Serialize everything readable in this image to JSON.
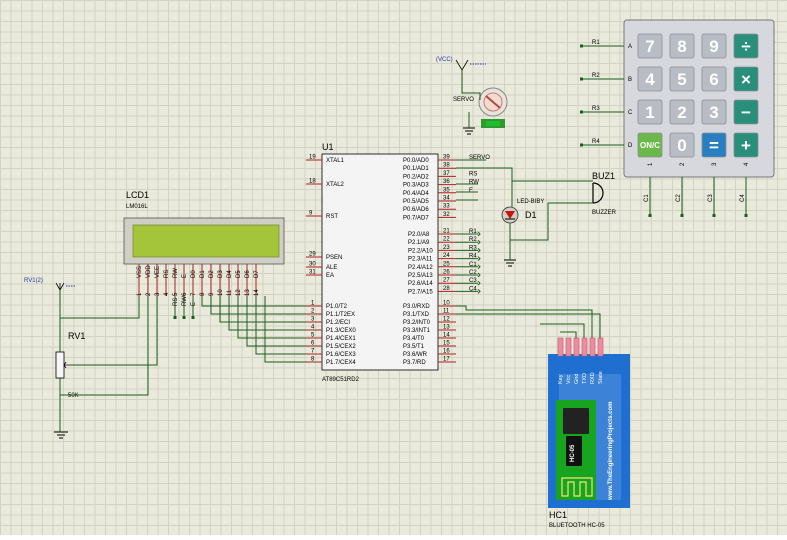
{
  "u1": {
    "ref": "U1",
    "part": "AT89C51RD2",
    "left_pins": [
      {
        "num": "19",
        "name": "XTAL1"
      },
      {
        "num": "18",
        "name": "XTAL2"
      },
      {
        "num": "9",
        "name": "RST"
      },
      {
        "num": "29",
        "name": "PSEN"
      },
      {
        "num": "30",
        "name": "ALE"
      },
      {
        "num": "31",
        "name": "EA"
      }
    ],
    "p1_pins": [
      {
        "num": "1",
        "name": "P1.0/T2"
      },
      {
        "num": "2",
        "name": "P1.1/T2EX"
      },
      {
        "num": "3",
        "name": "P1.2/ECI"
      },
      {
        "num": "4",
        "name": "P1.3/CEX0"
      },
      {
        "num": "5",
        "name": "P1.4/CEX1"
      },
      {
        "num": "6",
        "name": "P1.5/CEX2"
      },
      {
        "num": "7",
        "name": "P1.6/CEX3"
      },
      {
        "num": "8",
        "name": "P1.7/CEX4"
      }
    ],
    "p0_pins": [
      {
        "num": "39",
        "name": "P0.0/AD0"
      },
      {
        "num": "38",
        "name": "P0.1/AD1"
      },
      {
        "num": "37",
        "name": "P0.2/AD2"
      },
      {
        "num": "36",
        "name": "P0.3/AD3"
      },
      {
        "num": "35",
        "name": "P0.4/AD4"
      },
      {
        "num": "34",
        "name": "P0.5/AD5"
      },
      {
        "num": "33",
        "name": "P0.6/AD6"
      },
      {
        "num": "32",
        "name": "P0.7/AD7"
      }
    ],
    "p2_pins": [
      {
        "num": "21",
        "name": "P2.0/A8"
      },
      {
        "num": "22",
        "name": "P2.1/A9"
      },
      {
        "num": "23",
        "name": "P2.2/A10"
      },
      {
        "num": "24",
        "name": "P2.3/A11"
      },
      {
        "num": "25",
        "name": "P2.4/A12"
      },
      {
        "num": "26",
        "name": "P2.5/A13"
      },
      {
        "num": "27",
        "name": "P2.6/A14"
      },
      {
        "num": "28",
        "name": "P2.7/A15"
      }
    ],
    "p3_pins": [
      {
        "num": "10",
        "name": "P3.0/RXD"
      },
      {
        "num": "11",
        "name": "P3.1/TXD"
      },
      {
        "num": "12",
        "name": "P3.2/INT0"
      },
      {
        "num": "13",
        "name": "P3.3/INT1"
      },
      {
        "num": "14",
        "name": "P3.4/T0"
      },
      {
        "num": "15",
        "name": "P3.5/T1"
      },
      {
        "num": "16",
        "name": "P3.6/WR"
      },
      {
        "num": "17",
        "name": "P3.7/RD"
      }
    ],
    "p0_labels": [
      "SERVO",
      "",
      "RS",
      "RW",
      "E",
      "",
      "",
      ""
    ],
    "p2_labels": [
      "R1",
      "R2",
      "R3",
      "R4",
      "C1",
      "C2",
      "C3",
      "C4"
    ]
  },
  "lcd": {
    "ref": "LCD1",
    "part": "LM016L",
    "pins": [
      "VSS",
      "VDD",
      "VEE",
      "RS",
      "RW",
      "E",
      "D0",
      "D1",
      "D2",
      "D3",
      "D4",
      "D5",
      "D6",
      "D7"
    ],
    "pin_nums": [
      "1",
      "2",
      "3",
      "4",
      "5",
      "6",
      "7",
      "8",
      "9",
      "10",
      "11",
      "12",
      "13",
      "14"
    ],
    "bottom_labels": [
      "RS",
      "RW",
      "E"
    ],
    "display_color": "#a4c43a"
  },
  "rv": {
    "ref": "RV1",
    "value": "50K",
    "power_label": "RV1(2)"
  },
  "servo": {
    "label": "SERVO",
    "power_label": "(VCC)",
    "badge_color": "#2e9a2e"
  },
  "led": {
    "ref": "D1",
    "part": "LED-BIBY",
    "color": "#cc1111"
  },
  "buzzer": {
    "ref": "BUZ1",
    "part": "BUZZER"
  },
  "keypad": {
    "rows": [
      "A",
      "B",
      "C",
      "D"
    ],
    "row_nets": [
      "R1",
      "R2",
      "R3",
      "R4"
    ],
    "cols": [
      "1",
      "2",
      "3",
      "4"
    ],
    "col_nets": [
      "C1",
      "C2",
      "C3",
      "C4"
    ],
    "keys": [
      [
        "7",
        "8",
        "9",
        "÷"
      ],
      [
        "4",
        "5",
        "6",
        "×"
      ],
      [
        "1",
        "2",
        "3",
        "−"
      ],
      [
        "ON/C",
        "0",
        "=",
        "+"
      ]
    ],
    "op_color": "#2a8f7a",
    "eq_color": "#2a7fc0",
    "on_color": "#6cb84a"
  },
  "hc05": {
    "ref": "HC1",
    "part": "BLUETOOTH HC-05",
    "pins": [
      "Key",
      "Vcc",
      "Gnd",
      "TXD",
      "RXD",
      "State"
    ],
    "module_label": "HC-05",
    "site": "www.TheEngineeringProjects.com",
    "board_color": "#1e6fd0",
    "pcb_color": "#17a51f"
  }
}
